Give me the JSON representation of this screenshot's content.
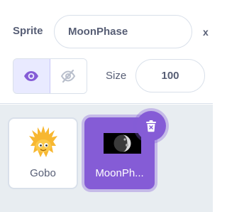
{
  "sprite_info": {
    "sprite_label": "Sprite",
    "sprite_name": "MoonPhase",
    "x_label": "x",
    "size_label": "Size",
    "size_value": "100",
    "show_icon": "eye-icon",
    "hide_icon": "eye-slash-icon"
  },
  "sprites": [
    {
      "name": "Gobo",
      "icon": "gobo-costume",
      "selected": false
    },
    {
      "name": "MoonPh...",
      "icon": "moon-costume",
      "selected": true
    }
  ],
  "colors": {
    "accent": "#855cd6",
    "text": "#575e75",
    "list_bg": "#e8edf1",
    "border": "#d9e0ea"
  },
  "delete_icon": "trash-icon"
}
